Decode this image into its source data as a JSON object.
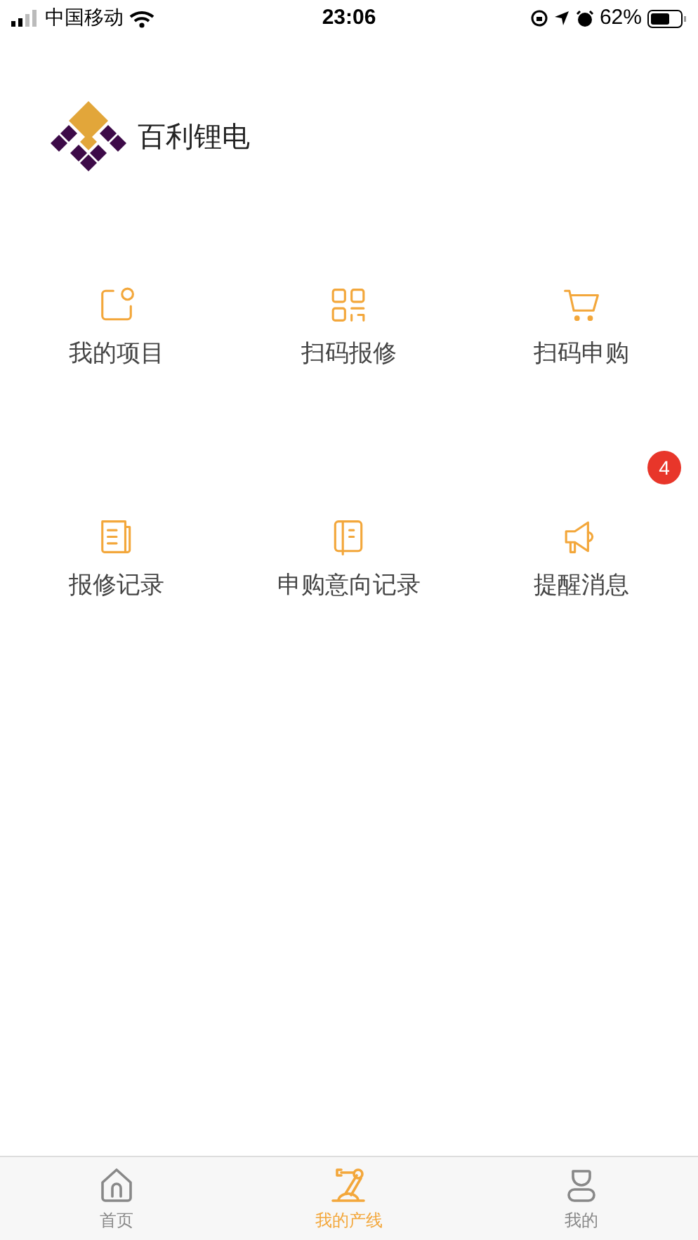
{
  "status_bar": {
    "carrier": "中国移动",
    "time": "23:06",
    "battery": "62%"
  },
  "brand": {
    "name": "百利锂电"
  },
  "menu": [
    {
      "kind": "project",
      "label": "我的项目"
    },
    {
      "kind": "scan",
      "label": "扫码报修"
    },
    {
      "kind": "cart",
      "label": "扫码申购"
    },
    {
      "kind": "doc",
      "label": "报修记录"
    },
    {
      "kind": "book",
      "label": "申购意向记录"
    },
    {
      "kind": "megaphone",
      "label": "提醒消息",
      "badge": "4"
    }
  ],
  "tab_bar": [
    {
      "kind": "home",
      "label": "首页",
      "selected": false
    },
    {
      "kind": "robot",
      "label": "我的产线",
      "selected": true
    },
    {
      "kind": "user",
      "label": "我的",
      "selected": false
    }
  ]
}
